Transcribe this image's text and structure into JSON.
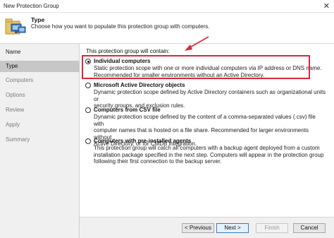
{
  "window": {
    "title": "New Protection Group",
    "close_glyph": "✕"
  },
  "header": {
    "title": "Type",
    "subtitle": "Choose how you want to populate this protection group with computers.",
    "icon": "protection-group-computers-icon"
  },
  "sidebar": {
    "steps": [
      {
        "label": "Name",
        "state": "done"
      },
      {
        "label": "Type",
        "state": "active"
      },
      {
        "label": "Computers",
        "state": "pending"
      },
      {
        "label": "Options",
        "state": "pending"
      },
      {
        "label": "Review",
        "state": "pending"
      },
      {
        "label": "Apply",
        "state": "pending"
      },
      {
        "label": "Summary",
        "state": "pending"
      }
    ]
  },
  "main": {
    "intro": "This protection group will contain:",
    "options": [
      {
        "title": "Individual computers",
        "selected": true,
        "desc1": "Static protection scope with one or more individual computers via IP address or DNS name.",
        "desc2": "Recommended for smaller environments without an Active Directory."
      },
      {
        "title": "Microsoft Active Directory objects",
        "selected": false,
        "desc1": "Dynamic protection scope defined by Active Directory containers such as organizational units or",
        "desc2": "security groups, and exclusion rules."
      },
      {
        "title": "Computers from CSV file",
        "selected": false,
        "desc1": "Dynamic protection scope defined by the content of a comma-separated values (.csv) file with",
        "desc2": "computer names that is hosted on a file share. Recommended for larger environments without",
        "desc3": "Active Directory, or for CMDB integration."
      },
      {
        "title": "Computers with pre-installed agents",
        "selected": false,
        "desc1": "This protection group will catch all computers with a backup agent deployed from a custom",
        "desc2": "installation package specified in the next step.  Computers will appear in the protection group",
        "desc3": "following their first connection to the backup server."
      }
    ]
  },
  "footer": {
    "previous": "< Previous",
    "next": "Next >",
    "finish": "Finish",
    "cancel": "Cancel"
  },
  "annotation": {
    "color": "#d8283a"
  }
}
